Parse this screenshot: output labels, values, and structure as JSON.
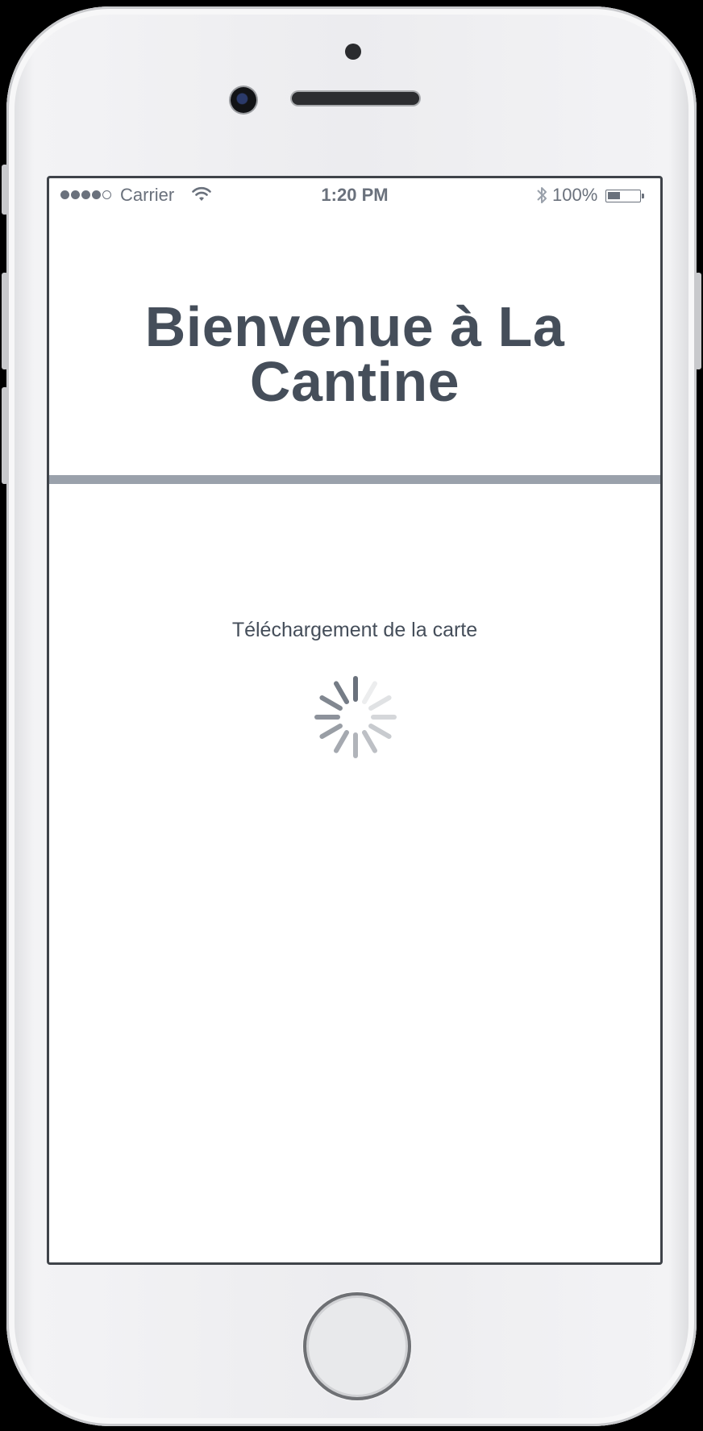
{
  "status_bar": {
    "carrier": "Carrier",
    "time": "1:20 PM",
    "battery_percent": "100%",
    "signal_bars_filled": 4,
    "signal_bars_total": 5,
    "battery_level": 0.4
  },
  "page": {
    "title_line1": "Bienvenue à La",
    "title_line2": "Cantine",
    "loading_text": "Téléchargement de la carte"
  },
  "icons": {
    "wifi": "wifi-icon",
    "bluetooth": "bluetooth-icon",
    "battery": "battery-icon",
    "spinner": "loading-spinner-icon"
  },
  "colors": {
    "text_primary": "#454e5a",
    "status_text": "#6a717c",
    "divider": "#9aa1ab",
    "background": "#ffffff"
  }
}
